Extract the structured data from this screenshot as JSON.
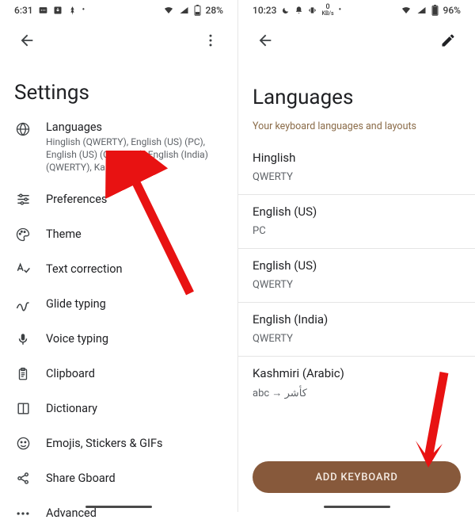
{
  "left": {
    "status": {
      "time": "6:31",
      "battery": "28%"
    },
    "pageTitle": "Settings",
    "items": [
      {
        "title": "Languages",
        "subtitle": "Hinglish (QWERTY), English (US) (PC), English (US) (QWERTY), English (India) (QWERTY), Kas…"
      },
      {
        "title": "Preferences"
      },
      {
        "title": "Theme"
      },
      {
        "title": "Text correction"
      },
      {
        "title": "Glide typing"
      },
      {
        "title": "Voice typing"
      },
      {
        "title": "Clipboard"
      },
      {
        "title": "Dictionary"
      },
      {
        "title": "Emojis, Stickers & GIFs"
      },
      {
        "title": "Share Gboard"
      },
      {
        "title": "Advanced"
      }
    ]
  },
  "right": {
    "status": {
      "time": "10:23",
      "netSpeed": "0",
      "netUnit": "KB/s",
      "battery": "96%"
    },
    "pageTitle": "Languages",
    "hint": "Your keyboard languages and layouts",
    "langs": [
      {
        "name": "Hinglish",
        "layout": "QWERTY"
      },
      {
        "name": "English (US)",
        "layout": "PC"
      },
      {
        "name": "English (US)",
        "layout": "QWERTY"
      },
      {
        "name": "English (India)",
        "layout": "QWERTY"
      },
      {
        "name": "Kashmiri (Arabic)",
        "layout": "abc → كأشر"
      }
    ],
    "addButton": "ADD KEYBOARD"
  }
}
